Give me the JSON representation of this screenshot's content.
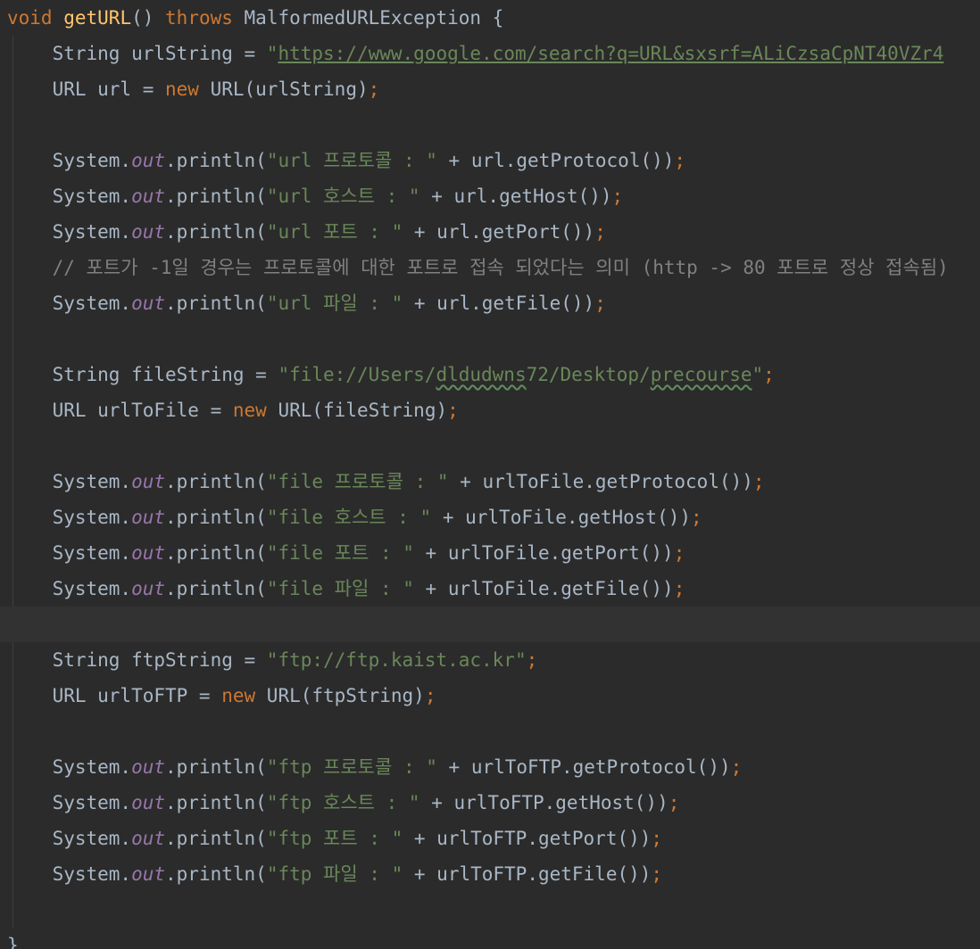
{
  "editor": {
    "lines": [
      [
        {
          "t": "void",
          "c": "kw"
        },
        {
          "t": " ",
          "c": "plain"
        },
        {
          "t": "getURL",
          "c": "fn"
        },
        {
          "t": "() ",
          "c": "plain"
        },
        {
          "t": "throws",
          "c": "kw"
        },
        {
          "t": " MalformedURLException {",
          "c": "plain"
        }
      ],
      [
        {
          "t": "    String urlString = ",
          "c": "plain"
        },
        {
          "t": "\"",
          "c": "str"
        },
        {
          "t": "https://www.google.com/search?q=URL&sxsrf=ALiCzsaCpNT40VZr4",
          "c": "str",
          "u": "link"
        }
      ],
      [
        {
          "t": "    URL url = ",
          "c": "plain"
        },
        {
          "t": "new",
          "c": "kw"
        },
        {
          "t": " URL(urlString)",
          "c": "plain"
        },
        {
          "t": ";",
          "c": "kw"
        }
      ],
      [],
      [
        {
          "t": "    System.",
          "c": "plain"
        },
        {
          "t": "out",
          "c": "field"
        },
        {
          "t": ".println(",
          "c": "plain"
        },
        {
          "t": "\"url 프로토콜 : \"",
          "c": "str"
        },
        {
          "t": " + url.getProtocol())",
          "c": "plain"
        },
        {
          "t": ";",
          "c": "kw"
        }
      ],
      [
        {
          "t": "    System.",
          "c": "plain"
        },
        {
          "t": "out",
          "c": "field"
        },
        {
          "t": ".println(",
          "c": "plain"
        },
        {
          "t": "\"url 호스트 : \"",
          "c": "str"
        },
        {
          "t": " + url.getHost())",
          "c": "plain"
        },
        {
          "t": ";",
          "c": "kw"
        }
      ],
      [
        {
          "t": "    System.",
          "c": "plain"
        },
        {
          "t": "out",
          "c": "field"
        },
        {
          "t": ".println(",
          "c": "plain"
        },
        {
          "t": "\"url 포트 : \"",
          "c": "str"
        },
        {
          "t": " + url.getPort())",
          "c": "plain"
        },
        {
          "t": ";",
          "c": "kw"
        }
      ],
      [
        {
          "t": "    // 포트가 -1일 경우는 프로토콜에 대한 포트로 접속 되었다는 의미 (http -> 80 포트로 정상 접속됨)",
          "c": "cmt"
        }
      ],
      [
        {
          "t": "    System.",
          "c": "plain"
        },
        {
          "t": "out",
          "c": "field"
        },
        {
          "t": ".println(",
          "c": "plain"
        },
        {
          "t": "\"url 파일 : \"",
          "c": "str"
        },
        {
          "t": " + url.getFile())",
          "c": "plain"
        },
        {
          "t": ";",
          "c": "kw"
        }
      ],
      [],
      [
        {
          "t": "    String fileString = ",
          "c": "plain"
        },
        {
          "t": "\"file://Users/",
          "c": "str"
        },
        {
          "t": "dldudwns",
          "c": "str",
          "u": "typo"
        },
        {
          "t": "72/Desktop/",
          "c": "str"
        },
        {
          "t": "precourse",
          "c": "str",
          "u": "typo"
        },
        {
          "t": "\"",
          "c": "str"
        },
        {
          "t": ";",
          "c": "kw"
        }
      ],
      [
        {
          "t": "    URL urlToFile = ",
          "c": "plain"
        },
        {
          "t": "new",
          "c": "kw"
        },
        {
          "t": " URL(fileString)",
          "c": "plain"
        },
        {
          "t": ";",
          "c": "kw"
        }
      ],
      [],
      [
        {
          "t": "    System.",
          "c": "plain"
        },
        {
          "t": "out",
          "c": "field"
        },
        {
          "t": ".println(",
          "c": "plain"
        },
        {
          "t": "\"file 프로토콜 : \"",
          "c": "str"
        },
        {
          "t": " + urlToFile.getProtocol())",
          "c": "plain"
        },
        {
          "t": ";",
          "c": "kw"
        }
      ],
      [
        {
          "t": "    System.",
          "c": "plain"
        },
        {
          "t": "out",
          "c": "field"
        },
        {
          "t": ".println(",
          "c": "plain"
        },
        {
          "t": "\"file 호스트 : \"",
          "c": "str"
        },
        {
          "t": " + urlToFile.getHost())",
          "c": "plain"
        },
        {
          "t": ";",
          "c": "kw"
        }
      ],
      [
        {
          "t": "    System.",
          "c": "plain"
        },
        {
          "t": "out",
          "c": "field"
        },
        {
          "t": ".println(",
          "c": "plain"
        },
        {
          "t": "\"file 포트 : \"",
          "c": "str"
        },
        {
          "t": " + urlToFile.getPort())",
          "c": "plain"
        },
        {
          "t": ";",
          "c": "kw"
        }
      ],
      [
        {
          "t": "    System.",
          "c": "plain"
        },
        {
          "t": "out",
          "c": "field"
        },
        {
          "t": ".println(",
          "c": "plain"
        },
        {
          "t": "\"file 파일 : \"",
          "c": "str"
        },
        {
          "t": " + urlToFile.getFile())",
          "c": "plain"
        },
        {
          "t": ";",
          "c": "kw"
        }
      ],
      [],
      [
        {
          "t": "    String ftpString = ",
          "c": "plain"
        },
        {
          "t": "\"ftp://ftp.kaist.ac.kr\"",
          "c": "str"
        },
        {
          "t": ";",
          "c": "kw"
        }
      ],
      [
        {
          "t": "    URL urlToFTP = ",
          "c": "plain"
        },
        {
          "t": "new",
          "c": "kw"
        },
        {
          "t": " URL(ftpString)",
          "c": "plain"
        },
        {
          "t": ";",
          "c": "kw"
        }
      ],
      [],
      [
        {
          "t": "    System.",
          "c": "plain"
        },
        {
          "t": "out",
          "c": "field"
        },
        {
          "t": ".println(",
          "c": "plain"
        },
        {
          "t": "\"ftp 프로토콜 : \"",
          "c": "str"
        },
        {
          "t": " + urlToFTP.getProtocol())",
          "c": "plain"
        },
        {
          "t": ";",
          "c": "kw"
        }
      ],
      [
        {
          "t": "    System.",
          "c": "plain"
        },
        {
          "t": "out",
          "c": "field"
        },
        {
          "t": ".println(",
          "c": "plain"
        },
        {
          "t": "\"ftp 호스트 : \"",
          "c": "str"
        },
        {
          "t": " + urlToFTP.getHost())",
          "c": "plain"
        },
        {
          "t": ";",
          "c": "kw"
        }
      ],
      [
        {
          "t": "    System.",
          "c": "plain"
        },
        {
          "t": "out",
          "c": "field"
        },
        {
          "t": ".println(",
          "c": "plain"
        },
        {
          "t": "\"ftp 포트 : \"",
          "c": "str"
        },
        {
          "t": " + urlToFTP.getPort())",
          "c": "plain"
        },
        {
          "t": ";",
          "c": "kw"
        }
      ],
      [
        {
          "t": "    System.",
          "c": "plain"
        },
        {
          "t": "out",
          "c": "field"
        },
        {
          "t": ".println(",
          "c": "plain"
        },
        {
          "t": "\"ftp 파일 : \"",
          "c": "str"
        },
        {
          "t": " + urlToFTP.getFile())",
          "c": "plain"
        },
        {
          "t": ";",
          "c": "kw"
        }
      ],
      [],
      [
        {
          "t": "}",
          "c": "plain"
        }
      ]
    ],
    "current_line": 17
  },
  "colors": {
    "background": "#2b2b2b",
    "keyword": "#cc7832",
    "function": "#ffc66d",
    "string": "#6a8759",
    "field": "#9876aa",
    "comment": "#808080",
    "text": "#a9b7c6"
  }
}
